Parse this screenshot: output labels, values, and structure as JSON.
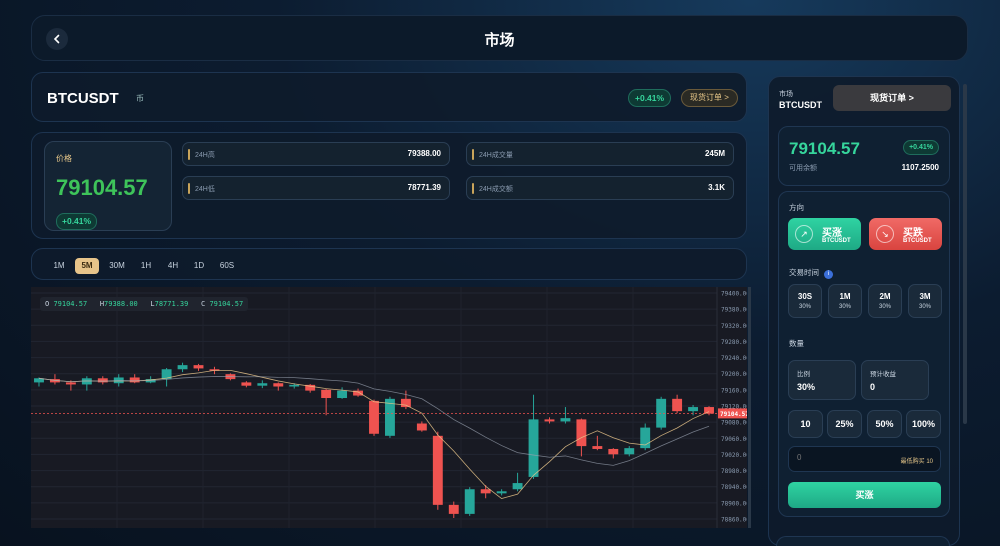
{
  "header": {
    "title": "市场"
  },
  "symbol": {
    "name": "BTCUSDT",
    "icon": "币",
    "change": "+0.41%",
    "spot_link": "现货订单 >"
  },
  "stats": {
    "price_label": "价格",
    "price": "79104.57",
    "change": "+0.41%",
    "items": [
      {
        "label": "24H高",
        "value": "79388.00"
      },
      {
        "label": "24H成交量",
        "value": "245M"
      },
      {
        "label": "24H低",
        "value": "78771.39"
      },
      {
        "label": "24H成交额",
        "value": "3.1K"
      }
    ]
  },
  "timeframes": {
    "items": [
      "1M",
      "5M",
      "30M",
      "1H",
      "4H",
      "1D",
      "60S"
    ],
    "active": "5M"
  },
  "ohlc": {
    "o": "O",
    "o_val": "79104.57",
    "h": "H",
    "h_val": "79388.00",
    "l": "L",
    "l_val": "78771.39",
    "c": "C",
    "c_val": "79104.57"
  },
  "chart_data": {
    "type": "candlestick",
    "y_ticks": [
      "79400.00",
      "79380.00",
      "79320.00",
      "79280.00",
      "79240.00",
      "79200.00",
      "79160.00",
      "79120.00",
      "79080.00",
      "79060.00",
      "79020.00",
      "78980.00",
      "78940.00",
      "78900.00",
      "78860.00"
    ],
    "ylim": [
      78850,
      79400
    ],
    "current_price": "79104.57",
    "candles": [
      {
        "o": 79180,
        "c": 79190,
        "h": 79192,
        "l": 79170
      },
      {
        "o": 79188,
        "c": 79180,
        "h": 79200,
        "l": 79175
      },
      {
        "o": 79180,
        "c": 79175,
        "h": 79185,
        "l": 79160
      },
      {
        "o": 79175,
        "c": 79190,
        "h": 79195,
        "l": 79160
      },
      {
        "o": 79190,
        "c": 79180,
        "h": 79195,
        "l": 79175
      },
      {
        "o": 79178,
        "c": 79192,
        "h": 79200,
        "l": 79170
      },
      {
        "o": 79192,
        "c": 79180,
        "h": 79200,
        "l": 79178
      },
      {
        "o": 79180,
        "c": 79188,
        "h": 79195,
        "l": 79178
      },
      {
        "o": 79188,
        "c": 79212,
        "h": 79215,
        "l": 79170
      },
      {
        "o": 79212,
        "c": 79222,
        "h": 79228,
        "l": 79205
      },
      {
        "o": 79222,
        "c": 79214,
        "h": 79225,
        "l": 79208
      },
      {
        "o": 79212,
        "c": 79210,
        "h": 79218,
        "l": 79200
      },
      {
        "o": 79200,
        "c": 79188,
        "h": 79202,
        "l": 79185
      },
      {
        "o": 79180,
        "c": 79172,
        "h": 79183,
        "l": 79168
      },
      {
        "o": 79172,
        "c": 79178,
        "h": 79185,
        "l": 79166
      },
      {
        "o": 79178,
        "c": 79170,
        "h": 79180,
        "l": 79160
      },
      {
        "o": 79170,
        "c": 79174,
        "h": 79178,
        "l": 79165
      },
      {
        "o": 79174,
        "c": 79160,
        "h": 79176,
        "l": 79155
      },
      {
        "o": 79162,
        "c": 79142,
        "h": 79164,
        "l": 79100
      },
      {
        "o": 79142,
        "c": 79160,
        "h": 79168,
        "l": 79140
      },
      {
        "o": 79160,
        "c": 79148,
        "h": 79165,
        "l": 79145
      },
      {
        "o": 79135,
        "c": 79055,
        "h": 79138,
        "l": 79050
      },
      {
        "o": 79050,
        "c": 79140,
        "h": 79145,
        "l": 79045
      },
      {
        "o": 79140,
        "c": 79120,
        "h": 79160,
        "l": 79115
      },
      {
        "o": 79080,
        "c": 79063,
        "h": 79085,
        "l": 79060
      },
      {
        "o": 79050,
        "c": 78882,
        "h": 79060,
        "l": 78870
      },
      {
        "o": 78882,
        "c": 78860,
        "h": 78890,
        "l": 78850
      },
      {
        "o": 78860,
        "c": 78920,
        "h": 78925,
        "l": 78855
      },
      {
        "o": 78920,
        "c": 78910,
        "h": 78930,
        "l": 78898
      },
      {
        "o": 78910,
        "c": 78915,
        "h": 78920,
        "l": 78905
      },
      {
        "o": 78920,
        "c": 78935,
        "h": 78960,
        "l": 78915
      },
      {
        "o": 78950,
        "c": 79090,
        "h": 79150,
        "l": 78945
      },
      {
        "o": 79090,
        "c": 79085,
        "h": 79095,
        "l": 79080
      },
      {
        "o": 79085,
        "c": 79093,
        "h": 79120,
        "l": 79080
      },
      {
        "o": 79090,
        "c": 79025,
        "h": 79092,
        "l": 79000
      },
      {
        "o": 79025,
        "c": 79018,
        "h": 79050,
        "l": 79015
      },
      {
        "o": 79018,
        "c": 79005,
        "h": 79020,
        "l": 78995
      },
      {
        "o": 79005,
        "c": 79020,
        "h": 79025,
        "l": 79000
      },
      {
        "o": 79020,
        "c": 79070,
        "h": 79080,
        "l": 79015
      },
      {
        "o": 79070,
        "c": 79140,
        "h": 79145,
        "l": 79065
      },
      {
        "o": 79140,
        "c": 79110,
        "h": 79150,
        "l": 79105
      },
      {
        "o": 79110,
        "c": 79120,
        "h": 79125,
        "l": 79100
      },
      {
        "o": 79120,
        "c": 79104,
        "h": 79122,
        "l": 79100
      }
    ]
  },
  "sidebar": {
    "market_label": "市场",
    "symbol": "BTCUSDT",
    "spot_btn": "现货订单 >",
    "price": "79104.57",
    "change": "+0.41%",
    "balance_label": "可用余额",
    "balance": "1107.2500",
    "direction_label": "方向",
    "buy_up": "买涨",
    "buy_up_sub": "BTCUSDT",
    "buy_down": "买跌",
    "buy_down_sub": "BTCUSDT",
    "time_label": "交易时间",
    "durations": [
      {
        "time": "30S",
        "rate": "30%"
      },
      {
        "time": "1M",
        "rate": "30%"
      },
      {
        "time": "2M",
        "rate": "30%"
      },
      {
        "time": "3M",
        "rate": "30%"
      }
    ],
    "qty_label": "数量",
    "ratio_label": "比例",
    "ratio_val": "30%",
    "profit_label": "预计收益",
    "profit_val": "0",
    "pcts": [
      "10",
      "25%",
      "50%",
      "100%"
    ],
    "amount_placeholder": "0",
    "min_hint": "最低购买 10",
    "submit": "买涨"
  },
  "colors": {
    "up": "#26a69a",
    "down": "#ef5350",
    "accent": "#36d59c",
    "gold": "#e7c48a"
  }
}
